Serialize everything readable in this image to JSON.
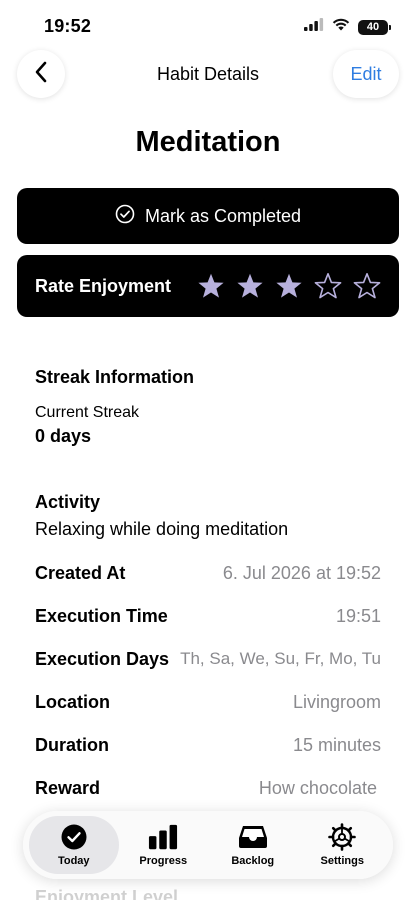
{
  "status": {
    "time": "19:52",
    "battery": "40"
  },
  "nav": {
    "title": "Habit Details",
    "edit_label": "Edit"
  },
  "habit": {
    "name": "Meditation"
  },
  "actions": {
    "complete_label": "Mark as Completed"
  },
  "rating": {
    "label": "Rate Enjoyment",
    "value": 3,
    "max": 5,
    "star_color": "#b7b0dc"
  },
  "streak": {
    "section_title": "Streak Information",
    "label": "Current Streak",
    "value": "0 days"
  },
  "activity": {
    "label": "Activity",
    "value": "Relaxing while doing meditation"
  },
  "details": [
    {
      "label": "Created At",
      "value": "6. Jul 2026 at 19:52"
    },
    {
      "label": "Execution Time",
      "value": "19:51"
    },
    {
      "label": "Execution Days",
      "value": "Th, Sa, We, Su, Fr, Mo, Tu"
    },
    {
      "label": "Location",
      "value": "Livingroom"
    },
    {
      "label": "Duration",
      "value": "15 minutes"
    },
    {
      "label": "Reward",
      "value": "How chocolate"
    }
  ],
  "faded": {
    "label": "Enjoyment Level"
  },
  "tabs": [
    {
      "label": "Today",
      "icon": "checkmark-circle-icon",
      "active": true
    },
    {
      "label": "Progress",
      "icon": "bar-chart-icon",
      "active": false
    },
    {
      "label": "Backlog",
      "icon": "tray-icon",
      "active": false
    },
    {
      "label": "Settings",
      "icon": "gear-icon",
      "active": false
    }
  ]
}
